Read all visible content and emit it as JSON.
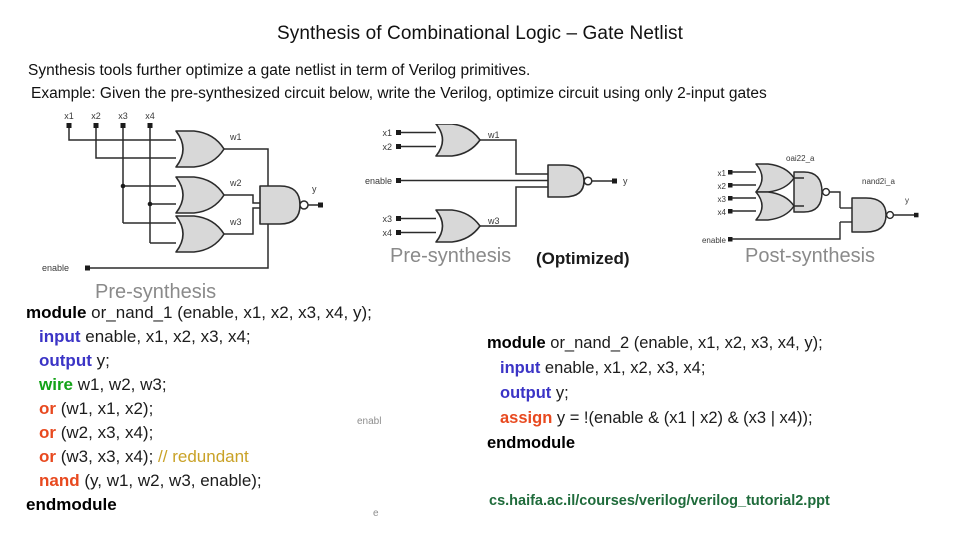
{
  "slide": {
    "title": "Synthesis of Combinational Logic – Gate Netlist",
    "body_lines": [
      "Synthesis tools further optimize a gate netlist in term of Verilog primitives.",
      "Example:  Given the pre-synthesized circuit below, write the Verilog, optimize circuit using only 2-input gates"
    ],
    "footer_url": "cs.haifa.ac.il/courses/verilog/verilog_tutorial2.ppt",
    "artifacts": [
      "enabl",
      "e"
    ]
  },
  "diagrams": {
    "left": {
      "caption": "Pre-synthesis",
      "inputs": [
        "x1",
        "x2",
        "x3",
        "x4"
      ],
      "enable_label": "enable",
      "wires": [
        "w1",
        "w2",
        "w3"
      ],
      "output": "y",
      "gates": [
        "or",
        "or",
        "or",
        "nand"
      ]
    },
    "middle": {
      "caption": "Pre-synthesis",
      "caption_suffix": "(Optimized)",
      "inputs": [
        "x1",
        "x2",
        "x3",
        "x4"
      ],
      "enable_label": "enable",
      "wires": [
        "w1",
        "w3"
      ],
      "output": "y",
      "gates": [
        "or",
        "or",
        "nand"
      ]
    },
    "right": {
      "caption": "Post-synthesis",
      "inputs": [
        "x1",
        "x2",
        "x3",
        "x4"
      ],
      "enable_label": "enable",
      "cell_labels": [
        "oai22_a",
        "nand2i_a"
      ],
      "output": "y"
    }
  },
  "code_left": {
    "lines": [
      {
        "parts": [
          {
            "t": "module ",
            "c": "kw-blk"
          },
          {
            "t": "or_nand_1 (enable, x1, x2, x3, x4, y);",
            "c": ""
          }
        ]
      },
      {
        "indent": true,
        "parts": [
          {
            "t": "input ",
            "c": "kw-blue"
          },
          {
            "t": "enable, x1, x2, x3, x4;",
            "c": ""
          }
        ]
      },
      {
        "indent": true,
        "parts": [
          {
            "t": "output ",
            "c": "kw-blue"
          },
          {
            "t": "y;",
            "c": ""
          }
        ]
      },
      {
        "indent": true,
        "parts": [
          {
            "t": "wire ",
            "c": "kw-green"
          },
          {
            "t": "w1, w2, w3;",
            "c": ""
          }
        ]
      },
      {
        "indent": true,
        "parts": [
          {
            "t": "or ",
            "c": "kw-red"
          },
          {
            "t": "(w1, x1, x2);",
            "c": ""
          }
        ]
      },
      {
        "indent": true,
        "parts": [
          {
            "t": "or ",
            "c": "kw-red"
          },
          {
            "t": "(w2, x3, x4);",
            "c": ""
          }
        ]
      },
      {
        "indent": true,
        "parts": [
          {
            "t": "or ",
            "c": "kw-red"
          },
          {
            "t": "(w3, x3, x4); ",
            "c": ""
          },
          {
            "t": "// redundant",
            "c": "cmt"
          }
        ]
      },
      {
        "indent": true,
        "parts": [
          {
            "t": "nand ",
            "c": "kw-red"
          },
          {
            "t": "(y, w1, w2, w3, enable);",
            "c": ""
          }
        ]
      },
      {
        "parts": [
          {
            "t": "endmodule",
            "c": "kw-blk"
          }
        ]
      }
    ]
  },
  "code_right": {
    "lines": [
      {
        "parts": [
          {
            "t": "module ",
            "c": "kw-blk"
          },
          {
            "t": "or_nand_2 (enable, x1, x2, x3, x4, y);",
            "c": ""
          }
        ]
      },
      {
        "indent": true,
        "parts": [
          {
            "t": "input ",
            "c": "kw-blue"
          },
          {
            "t": "enable, x1, x2, x3, x4;",
            "c": ""
          }
        ]
      },
      {
        "indent": true,
        "parts": [
          {
            "t": "output ",
            "c": "kw-blue"
          },
          {
            "t": "y;",
            "c": ""
          }
        ]
      },
      {
        "indent": true,
        "parts": [
          {
            "t": "assign ",
            "c": "kw-red"
          },
          {
            "t": "y = !(enable & (x1 | x2) & (x3 | x4));",
            "c": ""
          }
        ]
      },
      {
        "parts": [
          {
            "t": "endmodule",
            "c": "kw-blk"
          }
        ]
      }
    ]
  },
  "colors": {
    "keyword_black": "#000000",
    "keyword_blue": "#3b34c6",
    "keyword_green": "#13a318",
    "keyword_red": "#e8491f",
    "comment": "#c9a227",
    "footer_green": "#1f6b3b",
    "gate_fill": "#d8d8d8",
    "gate_stroke": "#2b2b2b"
  }
}
